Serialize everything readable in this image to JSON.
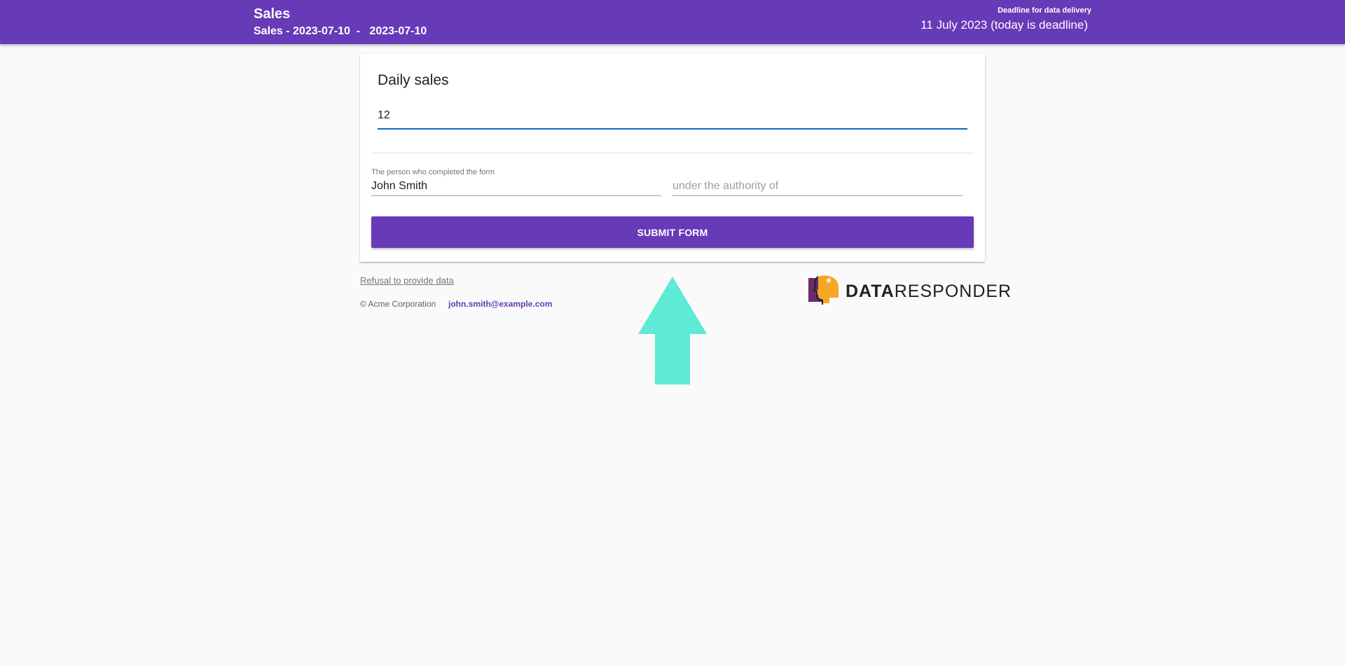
{
  "header": {
    "title": "Sales",
    "subtitle": "Sales - 2023-07-10  -   2023-07-10",
    "deadline_label": "Deadline for data delivery",
    "deadline_value": "11 July 2023 (today is deadline)"
  },
  "form": {
    "section_title": "Daily sales",
    "daily_sales_value": "12",
    "person_label": "The person who completed the form",
    "person_value": "John Smith",
    "authority_placeholder": "under the authority of",
    "submit_label": "SUBMIT FORM"
  },
  "footer": {
    "refusal_link": "Refusal to provide data",
    "copyright": "© Acme Corporation",
    "email": "john.smith@example.com"
  },
  "logo": {
    "text_bold": "DATA",
    "text_regular": "RESPONDER"
  },
  "colors": {
    "primary": "#673ab7",
    "arrow": "#5eead4",
    "logo_purple": "#6b2a6e",
    "logo_orange": "#f5a623"
  }
}
